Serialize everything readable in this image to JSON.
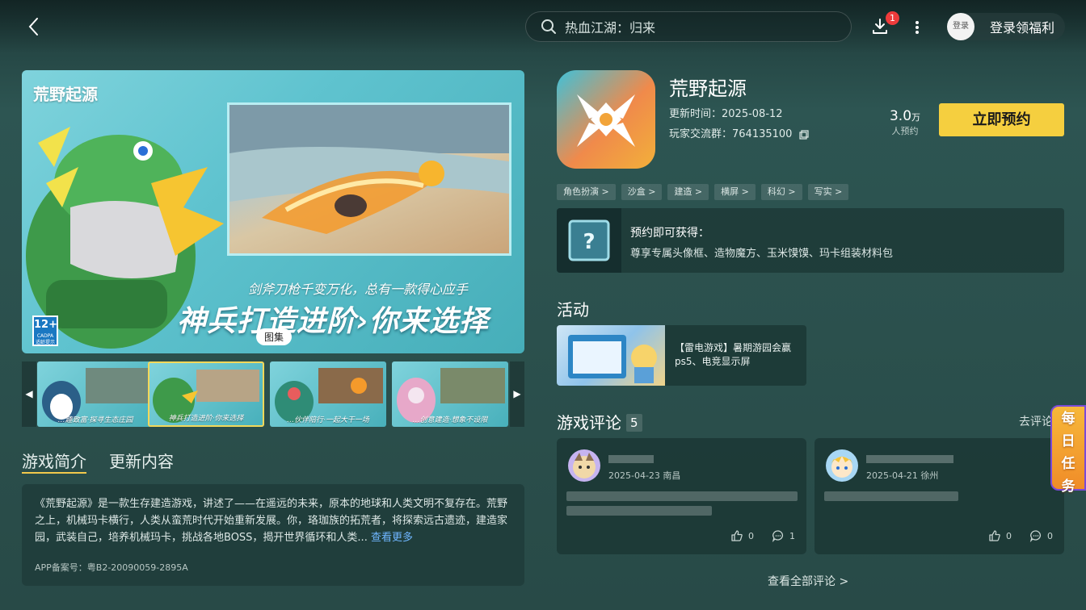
{
  "header": {
    "search_text": "热血江湖：归来",
    "download_badge": "1",
    "login_avatar_text": "登录",
    "login_cta": "登录领福利"
  },
  "hero": {
    "logo_text": "荒野起源",
    "slogan_small": "剑斧刀枪千变万化，总有一款得心应手",
    "slogan_large": "神兵打造进阶›你来选择",
    "age_rating": "12+",
    "age_rating_sub": "CADPA 适龄提示",
    "gallery_label": "图集"
  },
  "thumbnails": [
    {
      "caption": "…趣致富·探寻生态庄园"
    },
    {
      "caption": "神兵打造进阶·你来选择"
    },
    {
      "caption": "…伙伴陪行·一起大干一场"
    },
    {
      "caption": "…创意建造·想象不设限"
    }
  ],
  "tabs": [
    {
      "label": "游戏简介"
    },
    {
      "label": "更新内容"
    }
  ],
  "intro": {
    "text": "《荒野起源》是一款生存建造游戏，讲述了——在遥远的未来，原本的地球和人类文明不复存在。荒野之上，机械玛卡横行，人类从蛮荒时代开始重新发展。你，珞珈族的拓荒者，将探索远古遗迹，建造家园，武装自己，培养机械玛卡，挑战各地BOSS，揭开世界循环和人类...",
    "more_link": "查看更多",
    "beian": "APP备案号：粤B2-20090059-2895A"
  },
  "app": {
    "title": "荒野起源",
    "update_time": "更新时间：2025-08-12",
    "group_label": "玩家交流群：",
    "group_id": "764135100",
    "reserve_num": "3.0",
    "reserve_unit": "万",
    "reserve_label": "人预约",
    "reserve_button": "立即预约"
  },
  "tags": [
    "角色扮演 >",
    "沙盒 >",
    "建造 >",
    "横屏 >",
    "科幻 >",
    "写实 >"
  ],
  "reward": {
    "title": "预约即可获得：",
    "desc": "尊享专属头像框、造物魔方、玉米馍馍、玛卡组装材料包"
  },
  "activity": {
    "section_title": "活动",
    "text": "【雷电游戏】暑期游园会赢ps5、电竞显示屏"
  },
  "reviews": {
    "section_title": "游戏评论",
    "count": "5",
    "go_comment": "去评论",
    "all_comments": "查看全部评论 >",
    "items": [
      {
        "date": "2025-04-23 南昌",
        "likes": "0",
        "comments": "1"
      },
      {
        "date": "2025-04-21 徐州",
        "likes": "0",
        "comments": "0"
      }
    ]
  },
  "daily_task": {
    "chars": [
      "每",
      "日",
      "任",
      "务"
    ]
  },
  "colors": {
    "accent": "#f5cf3f",
    "link": "#6fb6ff",
    "badge": "#ef3b3b"
  }
}
